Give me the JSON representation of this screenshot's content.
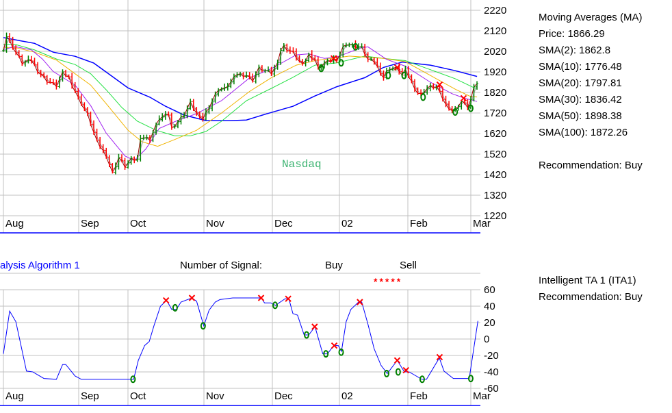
{
  "top_chart": {
    "watermark": "Nasdaq",
    "y_ticks": [
      "2220",
      "2120",
      "2020",
      "1920",
      "1820",
      "1720",
      "1620",
      "1520",
      "1420",
      "1320",
      "1220"
    ],
    "x_ticks": [
      "Aug",
      "Sep",
      "Oct",
      "Nov",
      "Dec",
      "02",
      "Feb",
      "Mar"
    ]
  },
  "ma_panel": {
    "title": "Moving Averages (MA)",
    "lines": [
      "Price:  1866.29",
      "SMA(2):  1862.8",
      "SMA(10):  1776.48",
      "SMA(20):  1797.81",
      "SMA(30):  1836.42",
      "SMA(50):  1898.38",
      "SMA(100):  1872.26"
    ],
    "recommendation": "Recommendation:  Buy"
  },
  "bottom_chart": {
    "title": "alysis Algorithm 1",
    "signal_label": "Number of Signal:",
    "buy_label": "Buy",
    "sell_label": "Sell",
    "sell_stars": "*****",
    "y_ticks": [
      "60",
      "40",
      "20",
      "0",
      "-20",
      "-40",
      "-60"
    ],
    "x_ticks": [
      "Aug",
      "Sep",
      "Oct",
      "Nov",
      "Dec",
      "02",
      "Feb",
      "Mar"
    ]
  },
  "ita_panel": {
    "title": "Intelligent TA 1 (ITA1)",
    "recommendation": "Recommendation:  Buy"
  },
  "colors": {
    "sma2": "#b0b0b0",
    "sma10": "#a020f0",
    "sma20": "#f0b400",
    "sma30": "#20e040",
    "sma50": "#0000ff",
    "up": "#008000",
    "down": "#ff0000",
    "ita": "#0000ff",
    "buy": "#008000",
    "sell": "#ff0000",
    "grid": "#c0c0c0"
  },
  "chart_data": [
    {
      "type": "line",
      "title": "Nasdaq",
      "x_unit": "trading day index (Aug start = 0)",
      "month_ticks": {
        "Aug": 0,
        "Sep": 24,
        "Oct": 40,
        "Nov": 64,
        "Dec": 86,
        "02": 108,
        "Feb": 130,
        "Mar": 150
      },
      "ylim": [
        1220,
        2220
      ],
      "series": [
        {
          "name": "Price",
          "points": [
            [
              0,
              2031
            ],
            [
              1,
              2093
            ],
            [
              2,
              2070
            ],
            [
              4,
              2014
            ],
            [
              6,
              1964
            ],
            [
              9,
              1976
            ],
            [
              11,
              1926
            ],
            [
              14,
              1876
            ],
            [
              17,
              1853
            ],
            [
              19,
              1913
            ],
            [
              21,
              1893
            ],
            [
              24,
              1793
            ],
            [
              27,
              1713
            ],
            [
              30,
              1580
            ],
            [
              33,
              1513
            ],
            [
              35,
              1427
            ],
            [
              37,
              1503
            ],
            [
              39,
              1460
            ],
            [
              41,
              1493
            ],
            [
              43,
              1493
            ],
            [
              44,
              1603
            ],
            [
              47,
              1593
            ],
            [
              50,
              1693
            ],
            [
              53,
              1713
            ],
            [
              54,
              1647
            ],
            [
              58,
              1713
            ],
            [
              60,
              1770
            ],
            [
              63,
              1693
            ],
            [
              64,
              1693
            ],
            [
              69,
              1837
            ],
            [
              71,
              1837
            ],
            [
              73,
              1870
            ],
            [
              75,
              1910
            ],
            [
              78,
              1903
            ],
            [
              80,
              1880
            ],
            [
              82,
              1937
            ],
            [
              86,
              1913
            ],
            [
              87.5,
              1947
            ],
            [
              89.5,
              2053
            ],
            [
              91,
              2030
            ],
            [
              93,
              2013
            ],
            [
              95,
              1970
            ],
            [
              96,
              1953
            ],
            [
              98,
              2003
            ],
            [
              100,
              1980
            ],
            [
              101,
              1937
            ],
            [
              103,
              1964
            ],
            [
              106,
              1980
            ],
            [
              107,
              1970
            ],
            [
              109.5,
              2060
            ],
            [
              112.5,
              2047
            ],
            [
              115,
              2037
            ],
            [
              117,
              1980
            ],
            [
              119,
              1970
            ],
            [
              122,
              1893
            ],
            [
              123.5,
              1937
            ],
            [
              126.5,
              1937
            ],
            [
              128,
              1903
            ],
            [
              129,
              1927
            ],
            [
              133.5,
              1803
            ],
            [
              136.5,
              1847
            ],
            [
              139,
              1847
            ],
            [
              142,
              1760
            ],
            [
              144.5,
              1727
            ],
            [
              147,
              1777
            ],
            [
              149.5,
              1743
            ],
            [
              150.5,
              1827
            ],
            [
              152,
              1866
            ]
          ]
        },
        {
          "name": "SMA(10)",
          "points": [
            [
              0,
              2027
            ],
            [
              3.5,
              2044
            ],
            [
              9,
              2027
            ],
            [
              12.5,
              1983
            ],
            [
              16,
              1922
            ],
            [
              23,
              1856
            ],
            [
              28,
              1756
            ],
            [
              33,
              1622
            ],
            [
              39,
              1511
            ],
            [
              42,
              1489
            ],
            [
              45.7,
              1545
            ],
            [
              50,
              1645
            ],
            [
              55,
              1678
            ],
            [
              62,
              1717
            ],
            [
              70,
              1780
            ],
            [
              79,
              1891
            ],
            [
              86,
              1936
            ],
            [
              94,
              2003
            ],
            [
              98,
              2008
            ],
            [
              103,
              1986
            ],
            [
              107,
              1992
            ],
            [
              114.5,
              2036
            ],
            [
              117,
              2042
            ],
            [
              123,
              1981
            ],
            [
              129,
              1948
            ],
            [
              137,
              1870
            ],
            [
              144,
              1814
            ],
            [
              148,
              1792
            ],
            [
              152,
              1776
            ]
          ]
        },
        {
          "name": "SMA(20)",
          "points": [
            [
              0,
              2038
            ],
            [
              4,
              2038
            ],
            [
              10,
              2016
            ],
            [
              17,
              1978
            ],
            [
              23,
              1911
            ],
            [
              28,
              1856
            ],
            [
              34,
              1747
            ],
            [
              40,
              1636
            ],
            [
              44.5,
              1580
            ],
            [
              49.5,
              1558
            ],
            [
              55,
              1591
            ],
            [
              62,
              1636
            ],
            [
              70,
              1720
            ],
            [
              79,
              1825
            ],
            [
              86,
              1892
            ],
            [
              94,
              1953
            ],
            [
              100,
              1975
            ],
            [
              111,
              1997
            ],
            [
              122,
              1986
            ],
            [
              129,
              1970
            ],
            [
              137,
              1903
            ],
            [
              145,
              1836
            ],
            [
              149.5,
              1803
            ],
            [
              152,
              1798
            ]
          ]
        },
        {
          "name": "SMA(30)",
          "points": [
            [
              0,
              2055
            ],
            [
              3.5,
              2055
            ],
            [
              10,
              2027
            ],
            [
              17,
              1983
            ],
            [
              23,
              1956
            ],
            [
              28,
              1911
            ],
            [
              33,
              1833
            ],
            [
              38,
              1747
            ],
            [
              43,
              1680
            ],
            [
              49,
              1636
            ],
            [
              55,
              1609
            ],
            [
              60,
              1609
            ],
            [
              65,
              1630
            ],
            [
              70,
              1680
            ],
            [
              78,
              1780
            ],
            [
              86,
              1840
            ],
            [
              92.7,
              1892
            ],
            [
              100,
              1953
            ],
            [
              107,
              1964
            ],
            [
              116,
              1997
            ],
            [
              122,
              1986
            ],
            [
              129,
              1975
            ],
            [
              137,
              1931
            ],
            [
              145,
              1887
            ],
            [
              152,
              1836
            ]
          ]
        },
        {
          "name": "SMA(50)",
          "points": [
            [
              0,
              2087
            ],
            [
              6,
              2070
            ],
            [
              10,
              2059
            ],
            [
              16,
              2016
            ],
            [
              23,
              1996
            ],
            [
              29,
              1963
            ],
            [
              35,
              1897
            ],
            [
              40,
              1842
            ],
            [
              47,
              1797
            ],
            [
              52,
              1753
            ],
            [
              58,
              1710
            ],
            [
              65,
              1683
            ],
            [
              73,
              1683
            ],
            [
              78,
              1686
            ],
            [
              84,
              1714
            ],
            [
              93,
              1753
            ],
            [
              100,
              1803
            ],
            [
              107,
              1848
            ],
            [
              116,
              1892
            ],
            [
              122,
              1942
            ],
            [
              128,
              1968
            ],
            [
              137,
              1953
            ],
            [
              145,
              1926
            ],
            [
              152,
              1898
            ]
          ]
        }
      ],
      "buy_signals": [
        [
          102,
          1937
        ],
        [
          108.4,
          1964
        ],
        [
          113,
          2042
        ],
        [
          123.5,
          1903
        ],
        [
          128.6,
          1903
        ],
        [
          134.7,
          1797
        ],
        [
          145,
          1725
        ],
        [
          150,
          1743
        ]
      ],
      "sell_signals": [
        [
          106,
          1986
        ],
        [
          126.4,
          1942
        ],
        [
          140,
          1858
        ],
        [
          147.7,
          1792
        ]
      ]
    },
    {
      "type": "line",
      "title": "Intelligent TA 1 (ITA1)",
      "ylim": [
        -60,
        60
      ],
      "series": [
        {
          "name": "ITA1",
          "points": [
            [
              0,
              -18
            ],
            [
              2,
              34
            ],
            [
              4,
              21
            ],
            [
              7.4,
              -39
            ],
            [
              9.4,
              -40
            ],
            [
              13,
              -48
            ],
            [
              17,
              -49
            ],
            [
              19,
              -31
            ],
            [
              20,
              -31
            ],
            [
              23,
              -45
            ],
            [
              25,
              -49
            ],
            [
              41.8,
              -49
            ],
            [
              43.3,
              -26
            ],
            [
              45.3,
              -8
            ],
            [
              46.8,
              -3
            ],
            [
              48.3,
              16
            ],
            [
              50.4,
              40
            ],
            [
              52.4,
              47
            ],
            [
              54,
              36
            ],
            [
              55.5,
              36
            ],
            [
              57,
              45
            ],
            [
              60.5,
              50
            ],
            [
              62,
              46
            ],
            [
              64.3,
              16
            ],
            [
              66,
              35
            ],
            [
              68,
              45
            ],
            [
              69.5,
              48
            ],
            [
              73.6,
              50
            ],
            [
              82.8,
              50
            ],
            [
              83.8,
              44
            ],
            [
              85.8,
              44
            ],
            [
              87.3,
              41
            ],
            [
              90.4,
              49
            ],
            [
              91.6,
              49
            ],
            [
              92.9,
              31
            ],
            [
              94.4,
              29
            ],
            [
              96.5,
              5
            ],
            [
              98,
              5
            ],
            [
              100,
              15
            ],
            [
              102.5,
              -18
            ],
            [
              104,
              -18
            ],
            [
              106,
              -8
            ],
            [
              107.5,
              -8
            ],
            [
              108.5,
              -15
            ],
            [
              110,
              21
            ],
            [
              111.5,
              36
            ],
            [
              114,
              45
            ],
            [
              115,
              45
            ],
            [
              117,
              18
            ],
            [
              119,
              -12
            ],
            [
              121.2,
              -32
            ],
            [
              123.2,
              -42
            ],
            [
              126.4,
              -26
            ],
            [
              128.7,
              -40
            ],
            [
              130.2,
              -40
            ],
            [
              134.3,
              -49
            ],
            [
              135.8,
              -49
            ],
            [
              139.9,
              -23
            ],
            [
              141.4,
              -39
            ],
            [
              144.4,
              -48
            ],
            [
              149.5,
              -48
            ],
            [
              152.3,
              22
            ]
          ]
        }
      ],
      "buy_signals": [
        [
          41.6,
          -49
        ],
        [
          55.1,
          38
        ],
        [
          64.1,
          16
        ],
        [
          87.2,
          41
        ],
        [
          97.3,
          5
        ],
        [
          103.5,
          -18
        ],
        [
          108.4,
          -16
        ],
        [
          123,
          -42
        ],
        [
          126.7,
          -40
        ],
        [
          134.4,
          -49
        ],
        [
          150,
          -48
        ]
      ],
      "sell_signals": [
        [
          52.2,
          47
        ],
        [
          60.5,
          50
        ],
        [
          82.7,
          50
        ],
        [
          91.4,
          49
        ],
        [
          99.9,
          15
        ],
        [
          106.2,
          -8
        ],
        [
          114.4,
          45
        ],
        [
          126.4,
          -26
        ],
        [
          129.2,
          -38
        ],
        [
          140,
          -22
        ]
      ]
    }
  ]
}
